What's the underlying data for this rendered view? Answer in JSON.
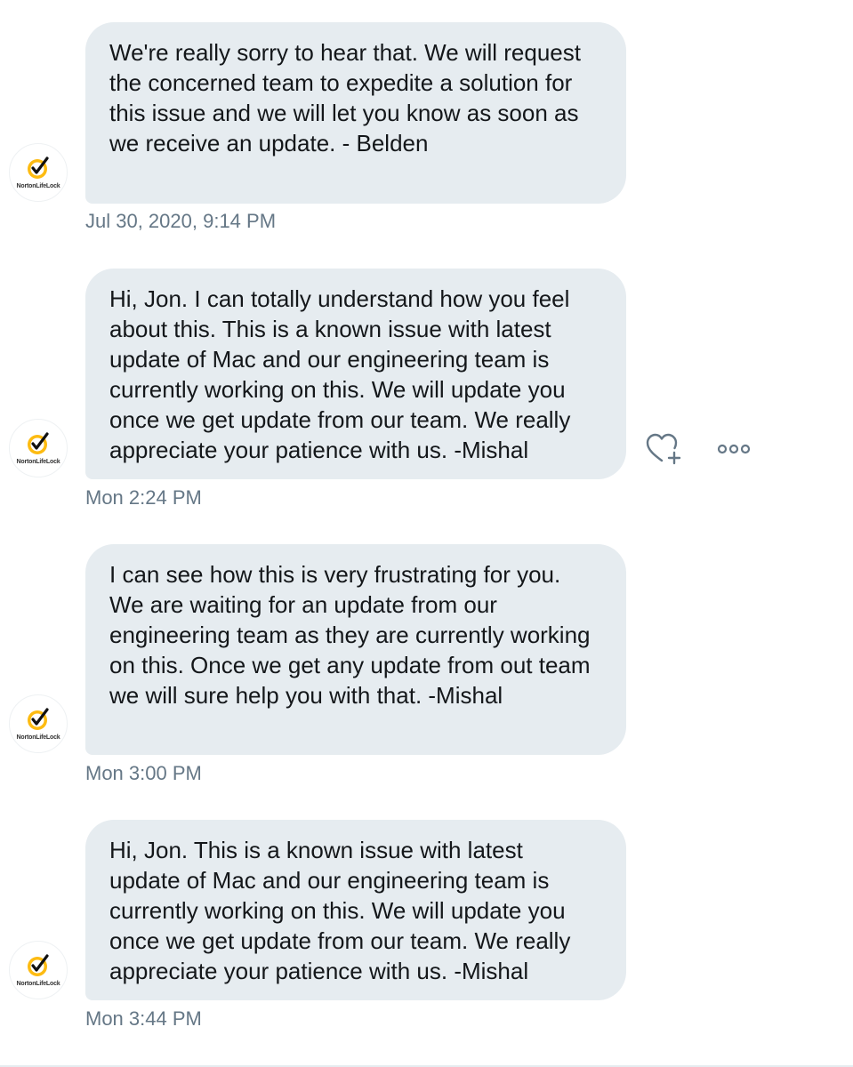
{
  "colors": {
    "bubble_bg": "#e6ecf0",
    "text": "#14171a",
    "timestamp": "#657786",
    "brand_yellow": "#fdbb11"
  },
  "brand": {
    "name": "NortonLifeLock",
    "logo_icon": "norton-checkmark-icon"
  },
  "messages": [
    {
      "text": "We're really sorry to hear that. We will request the concerned team to expedite a solution for this issue and  we will let you know as soon as we receive an update. - Belden",
      "timestamp": "Jul 30, 2020, 9:14 PM"
    },
    {
      "text": "Hi, Jon. I can totally understand how you feel about this. This is a known issue with latest update of Mac and our engineering team is currently working on this. We will update you once we get update from our team. We really appreciate your patience with us. -Mishal",
      "timestamp": "Mon 2:24 PM",
      "actions": [
        "add-reaction-icon",
        "more-options-icon"
      ]
    },
    {
      "text": "I can see how this is very frustrating for you. We are waiting for an update from our engineering team as they are currently working on this. Once we get any update from out team we will sure help you with that. -Mishal",
      "timestamp": "Mon 3:00 PM"
    },
    {
      "text": "Hi, Jon. This is a known issue with latest update of Mac and our engineering team is currently working on this. We will update you once we get update from our team. We really appreciate your patience with us. -Mishal",
      "timestamp": "Mon 3:44 PM"
    }
  ]
}
